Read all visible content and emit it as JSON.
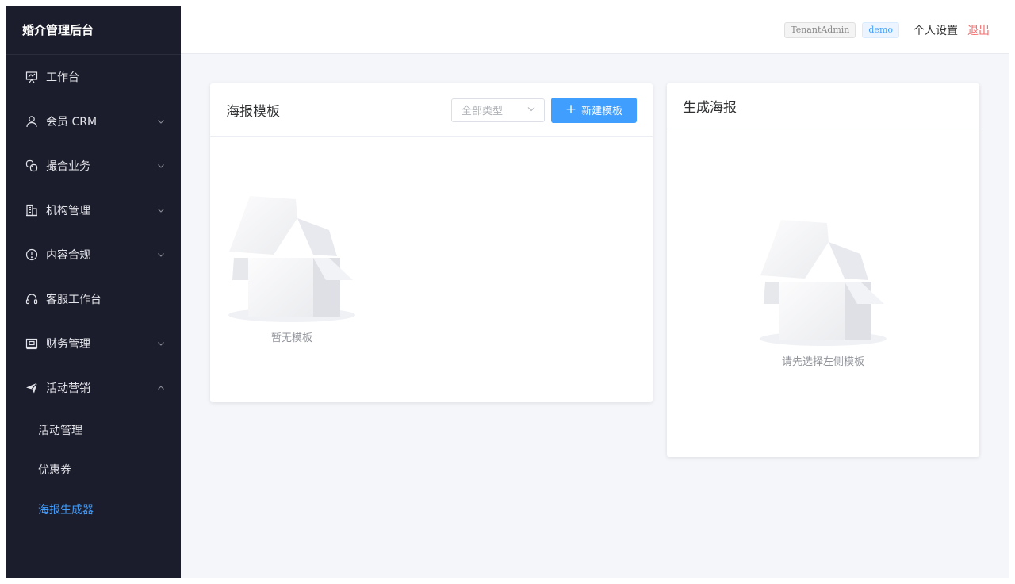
{
  "sidebar": {
    "brand": "婚介管理后台",
    "items": [
      {
        "label": "工作台",
        "icon": "presentation-icon",
        "expandable": false
      },
      {
        "label": "会员 CRM",
        "icon": "user-icon",
        "expandable": true
      },
      {
        "label": "撮合业务",
        "icon": "link-icon",
        "expandable": true
      },
      {
        "label": "机构管理",
        "icon": "building-icon",
        "expandable": true
      },
      {
        "label": "内容合规",
        "icon": "warning-circle-icon",
        "expandable": true
      },
      {
        "label": "客服工作台",
        "icon": "headset-icon",
        "expandable": false
      },
      {
        "label": "财务管理",
        "icon": "wallet-icon",
        "expandable": true
      },
      {
        "label": "活动营销",
        "icon": "send-icon",
        "expandable": true,
        "expanded": true
      }
    ],
    "sub_items": [
      {
        "label": "活动管理",
        "active": false
      },
      {
        "label": "优惠券",
        "active": false
      },
      {
        "label": "海报生成器",
        "active": true
      }
    ]
  },
  "header": {
    "tenant_tag": "TenantAdmin",
    "user_tag": "demo",
    "settings": "个人设置",
    "logout": "退出"
  },
  "templates_card": {
    "title": "海报模板",
    "type_select": "全部类型",
    "new_button": "新建模板",
    "empty_text": "暂无模板"
  },
  "generate_card": {
    "title": "生成海报",
    "empty_text": "请先选择左侧模板"
  },
  "colors": {
    "sidebar_bg": "#1c1d2c",
    "accent": "#409eff",
    "danger": "#f56c6c"
  }
}
